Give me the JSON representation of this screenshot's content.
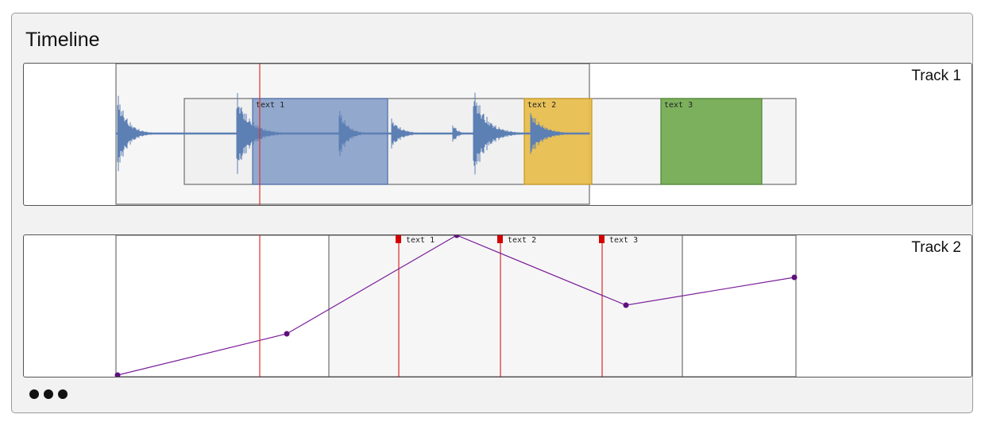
{
  "timeline": {
    "title": "Timeline",
    "tracks": [
      {
        "label": "Track 1",
        "segments": [
          {
            "label": "text 1",
            "color": "#7b96c4",
            "border": "#4e6fa8"
          },
          {
            "label": "text 2",
            "color": "#e6b83d",
            "border": "#c8961d"
          },
          {
            "label": "text 3",
            "color": "#6fa84c",
            "border": "#4c8631"
          }
        ]
      },
      {
        "label": "Track 2",
        "markers": [
          {
            "label": "text 1"
          },
          {
            "label": "text 2"
          },
          {
            "label": "text 3"
          }
        ],
        "automation_line_color": "#7b1f9a",
        "marker_color": "#d40000"
      }
    ],
    "playhead_color": "#e0302a"
  }
}
